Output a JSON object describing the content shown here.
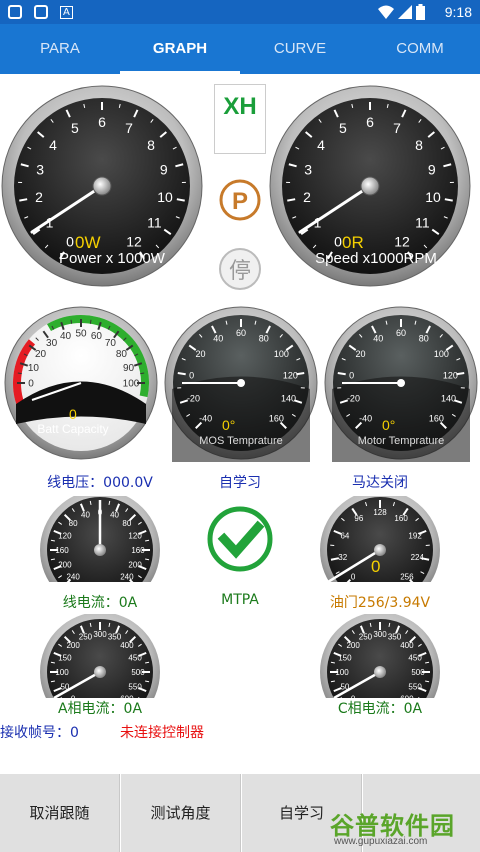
{
  "status": {
    "time": "9:18",
    "icon_a": "A",
    "icons": [
      "image-icon",
      "app-icon",
      "wifi-icon",
      "signal-icon",
      "battery-icon"
    ]
  },
  "tabs": [
    {
      "label": "PARA",
      "active": false
    },
    {
      "label": "GRAPH",
      "active": true
    },
    {
      "label": "CURVE",
      "active": false
    },
    {
      "label": "COMM",
      "active": false
    }
  ],
  "controls": {
    "xh_label": "XH",
    "park_label": "P",
    "stop_label": "停"
  },
  "power_gauge": {
    "ticks": [
      "0",
      "1",
      "2",
      "3",
      "4",
      "5",
      "6",
      "7",
      "8",
      "9",
      "10",
      "11",
      "12"
    ],
    "value": "0W",
    "label": "Power x 1000W"
  },
  "speed_gauge": {
    "ticks": [
      "0",
      "1",
      "2",
      "3",
      "4",
      "5",
      "6",
      "7",
      "8",
      "9",
      "10",
      "11",
      "12"
    ],
    "value": "0R",
    "label": "Speed x1000RPM"
  },
  "batt_gauge": {
    "ticks": [
      "0",
      "10",
      "20",
      "30",
      "40",
      "50",
      "60",
      "70",
      "80",
      "90",
      "100"
    ],
    "value": "0",
    "label": "Batt Capacity"
  },
  "mos_gauge": {
    "ticks": [
      "-40",
      "-20",
      "0",
      "20",
      "40",
      "60",
      "80",
      "100",
      "120",
      "140",
      "160"
    ],
    "value": "0°",
    "label": "MOS Temprature"
  },
  "motor_gauge": {
    "ticks": [
      "-40",
      "-20",
      "0",
      "20",
      "40",
      "60",
      "80",
      "100",
      "120",
      "140",
      "160"
    ],
    "value": "0°",
    "label": "Motor Temprature"
  },
  "line_current_gauge": {
    "ticks": [
      "240",
      "200",
      "160",
      "120",
      "80",
      "40",
      "0",
      "40",
      "80",
      "120",
      "160",
      "200",
      "240"
    ]
  },
  "throttle_gauge": {
    "ticks": [
      "0",
      "32",
      "64",
      "96",
      "128",
      "160",
      "192",
      "224",
      "256"
    ],
    "value": "0"
  },
  "phase_a_gauge": {
    "ticks": [
      "0",
      "50",
      "100",
      "150",
      "200",
      "250",
      "300",
      "350",
      "400",
      "450",
      "500",
      "550",
      "600"
    ]
  },
  "phase_c_gauge": {
    "ticks": [
      "0",
      "50",
      "100",
      "150",
      "200",
      "250",
      "300",
      "350",
      "400",
      "450",
      "500",
      "550",
      "600"
    ]
  },
  "readouts": {
    "line_voltage": "线电压：000.0V",
    "self_learn": "自学习",
    "motor_status": "马达关闭",
    "line_current": "线电流：0A",
    "mtpa": "MTPA",
    "throttle": "油门256/3.94V",
    "phase_a_current": "A相电流：0A",
    "phase_c_current": "C相电流：0A",
    "frame_count": "接收帧号：0",
    "connection_status": "未连接控制器"
  },
  "buttons": {
    "cancel_follow": "取消跟随",
    "test_angle": "测试角度",
    "self_learn": "自学习"
  },
  "watermark": {
    "text": "谷普软件园",
    "url": "www.gupuxiazai.com"
  },
  "colors": {
    "tab_bar": "#1976d2",
    "status_bar": "#1565c0",
    "readout_blue": "#1a2fb0",
    "readout_green": "#1b7a1b",
    "readout_orange": "#c77a00",
    "alert_red": "#e81010",
    "xh_green": "#1a9e3a",
    "park_orange": "#c77a2a",
    "check_green": "#22a33a"
  }
}
